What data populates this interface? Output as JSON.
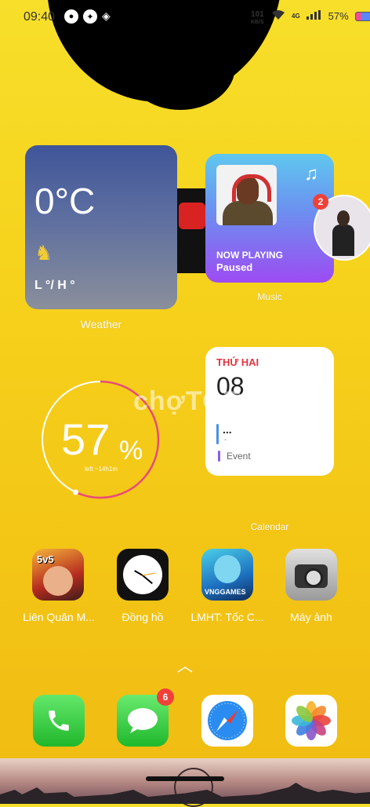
{
  "status": {
    "time": "09:40",
    "speed_value": "101",
    "speed_unit": "KB/S",
    "network": "4G",
    "battery": "57%"
  },
  "widgets": {
    "weather": {
      "temperature": "0°C",
      "range": "L °/ H °",
      "label": "Weather"
    },
    "music": {
      "now_playing": "NOW PLAYING",
      "state": "Paused",
      "label": "Music",
      "bubble_badge": "2"
    },
    "battery": {
      "value": "57",
      "unit": "%",
      "sub": "left ~14h1m",
      "level": 0.57
    },
    "calendar": {
      "weekday": "THỨ HAI",
      "date": "08",
      "event1": "...",
      "event1_sub": "-",
      "event2": "Event",
      "label": "Calendar"
    }
  },
  "watermark": "chợTOT",
  "apps": [
    {
      "name": "Liên Quân M...",
      "icon_text": "5v5"
    },
    {
      "name": "Đồng hồ"
    },
    {
      "name": "LMHT: Tốc C...",
      "icon_text": "VNGGAMES"
    },
    {
      "name": "Máy ảnh"
    }
  ],
  "dock": {
    "messages_badge": "6"
  }
}
